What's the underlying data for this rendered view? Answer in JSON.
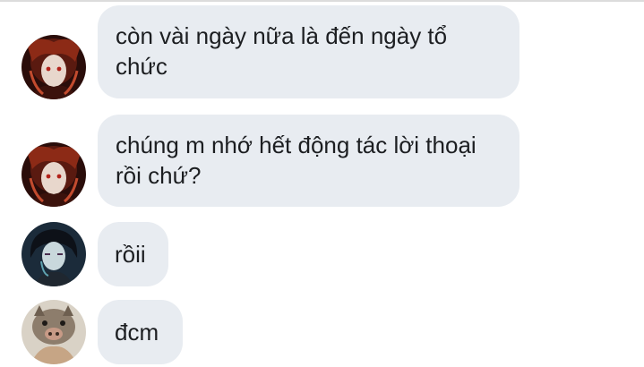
{
  "messages": [
    {
      "sender": "avatar-demon-red",
      "text": "còn vài ngày nữa là đến ngày tổ\nchức"
    },
    {
      "sender": "avatar-demon-red",
      "text": "chúng m nhớ hết động tác lời thoại\nrồi chứ?"
    },
    {
      "sender": "avatar-dark-haired",
      "text": "rồii"
    },
    {
      "sender": "avatar-boar-mask",
      "text": "đcm"
    }
  ],
  "colors": {
    "bubble_bg": "#e8ecf1",
    "text": "#1c1e21",
    "background": "#ffffff"
  }
}
